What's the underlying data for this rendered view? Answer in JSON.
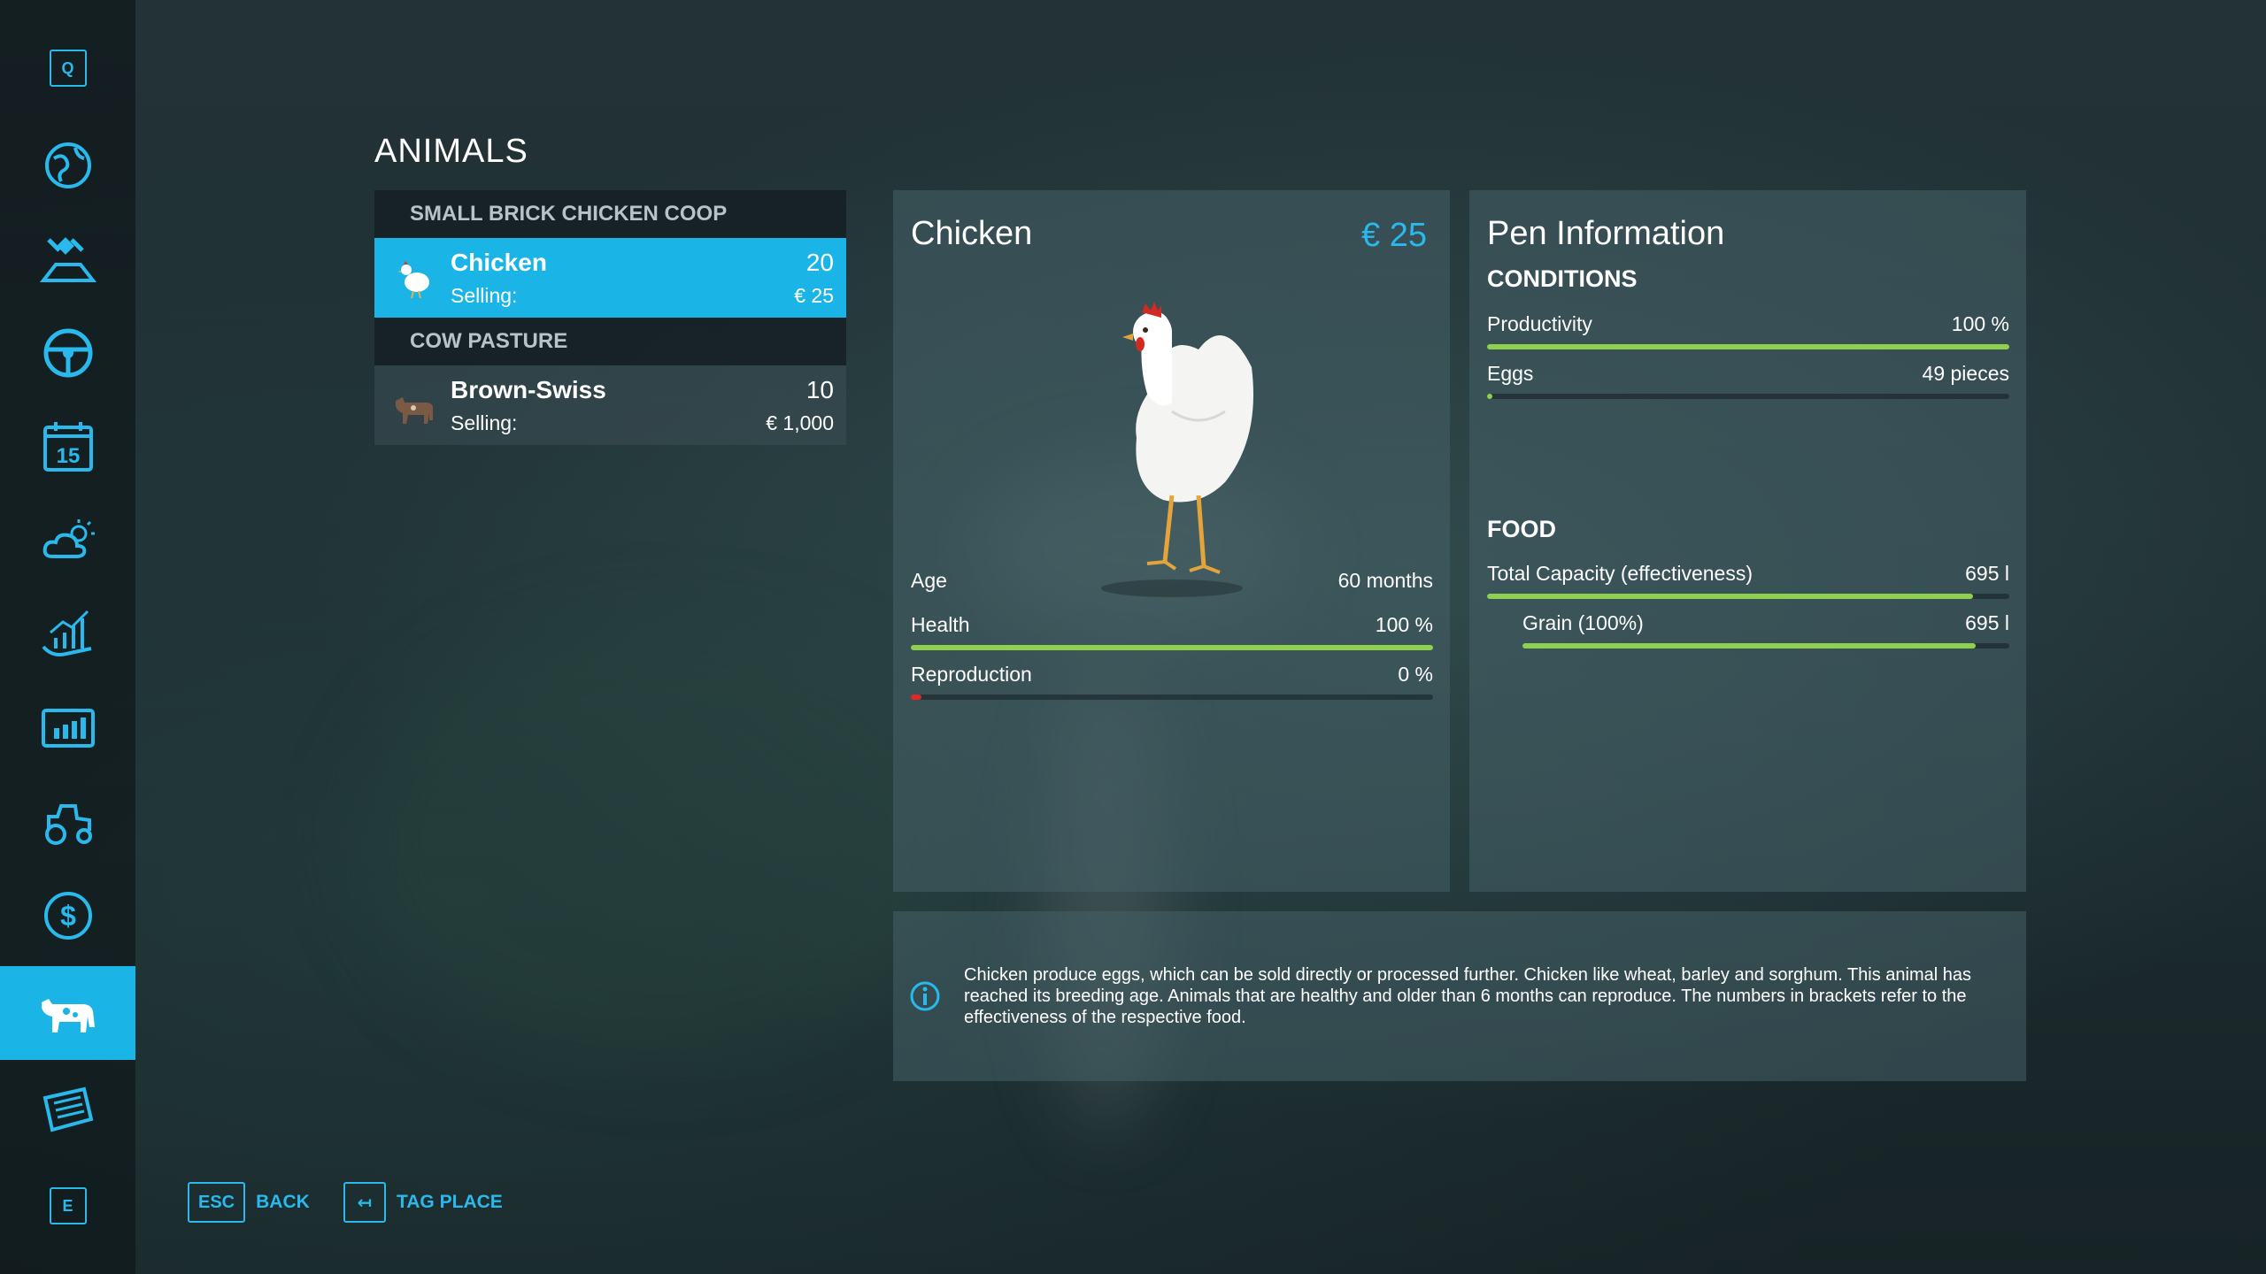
{
  "title": "ANIMALS",
  "sidebar": {
    "top_key": "Q",
    "bottom_key": "E",
    "items": [
      {
        "icon": "map-globe-icon"
      },
      {
        "icon": "satellite-field-icon"
      },
      {
        "icon": "steering-wheel-icon"
      },
      {
        "icon": "calendar-icon",
        "label": "15"
      },
      {
        "icon": "weather-icon"
      },
      {
        "icon": "prices-chart-icon"
      },
      {
        "icon": "statistics-icon"
      },
      {
        "icon": "tractor-icon"
      },
      {
        "icon": "finance-icon"
      },
      {
        "icon": "animals-icon",
        "active": true
      },
      {
        "icon": "contracts-icon"
      }
    ],
    "accent_color": "#1ab4e6"
  },
  "animal_list": {
    "sections": [
      {
        "header": "SMALL BRICK CHICKEN COOP",
        "animals": [
          {
            "name": "Chicken",
            "count": "20",
            "selling_label": "Selling:",
            "price": "€ 25",
            "selected": true
          }
        ]
      },
      {
        "header": "COW PASTURE",
        "animals": [
          {
            "name": "Brown-Swiss",
            "count": "10",
            "selling_label": "Selling:",
            "price": "€ 1,000",
            "selected": false
          }
        ]
      }
    ]
  },
  "detail": {
    "name": "Chicken",
    "price": "€ 25",
    "stats": {
      "age": {
        "label": "Age",
        "value": "60 months"
      },
      "health": {
        "label": "Health",
        "value": "100 %",
        "fraction": 1.0
      },
      "reproduction": {
        "label": "Reproduction",
        "value": "0 %",
        "fraction": 0.0
      }
    }
  },
  "pen": {
    "title": "Pen Information",
    "conditions_heading": "CONDITIONS",
    "productivity": {
      "label": "Productivity",
      "value": "100 %",
      "fraction": 1.0
    },
    "eggs": {
      "label": "Eggs",
      "value": "49 pieces",
      "fraction": 0.01
    },
    "food_heading": "FOOD",
    "total_capacity": {
      "label": "Total Capacity (effectiveness)",
      "value": "695 l",
      "fraction": 0.93
    },
    "grain": {
      "label": "Grain (100%)",
      "value": "695 l",
      "fraction": 0.93
    }
  },
  "info": {
    "text": "Chicken produce eggs, which can be sold directly or processed further. Chicken like wheat, barley and sorghum. This animal has reached its breeding age. Animals that are healthy and older than 6 months can reproduce. The numbers in brackets refer to the effectiveness of the respective food."
  },
  "bottom": {
    "back_key": "ESC",
    "back_label": "BACK",
    "tag_key": "↤",
    "tag_label": "TAG PLACE"
  },
  "colors": {
    "accent": "#29b9ec",
    "bar_green": "#8fd14f",
    "bar_red": "#e02828"
  }
}
